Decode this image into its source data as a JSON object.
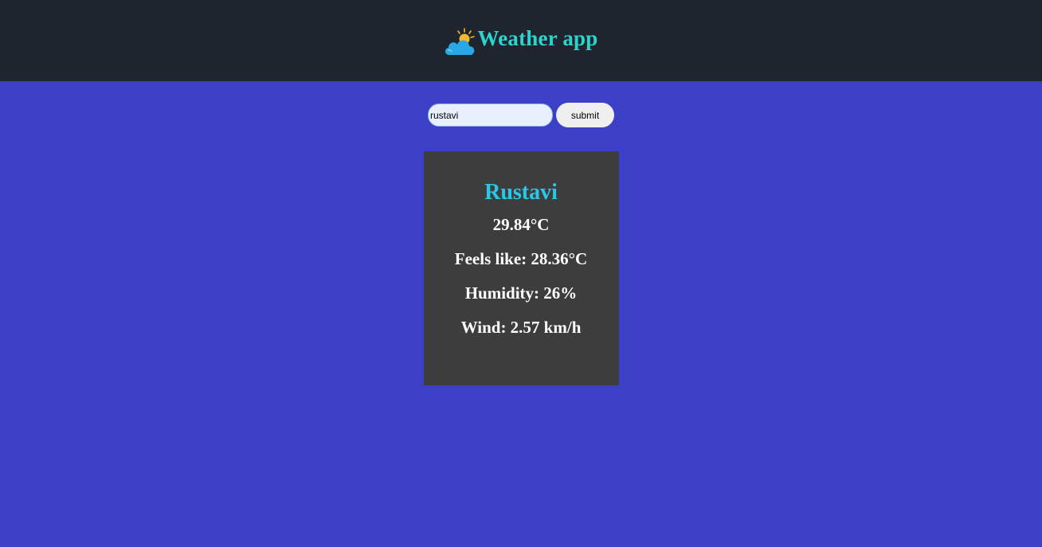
{
  "header": {
    "title": "Weather app",
    "logo_icon": "cloud-sun-icon"
  },
  "search": {
    "value": "rustavi",
    "submit_label": "submit"
  },
  "weather": {
    "city": "Rustavi",
    "temperature": "29.84°C",
    "feels_like": "Feels like: 28.36°C",
    "humidity": "Humidity: 26%",
    "wind": "Wind: 2.57 km/h"
  },
  "colors": {
    "background": "#3c40c6",
    "header_bg": "#1e252e",
    "title": "#2dd4cf",
    "card_bg": "#3d3d3d",
    "city": "#29c8e8"
  }
}
